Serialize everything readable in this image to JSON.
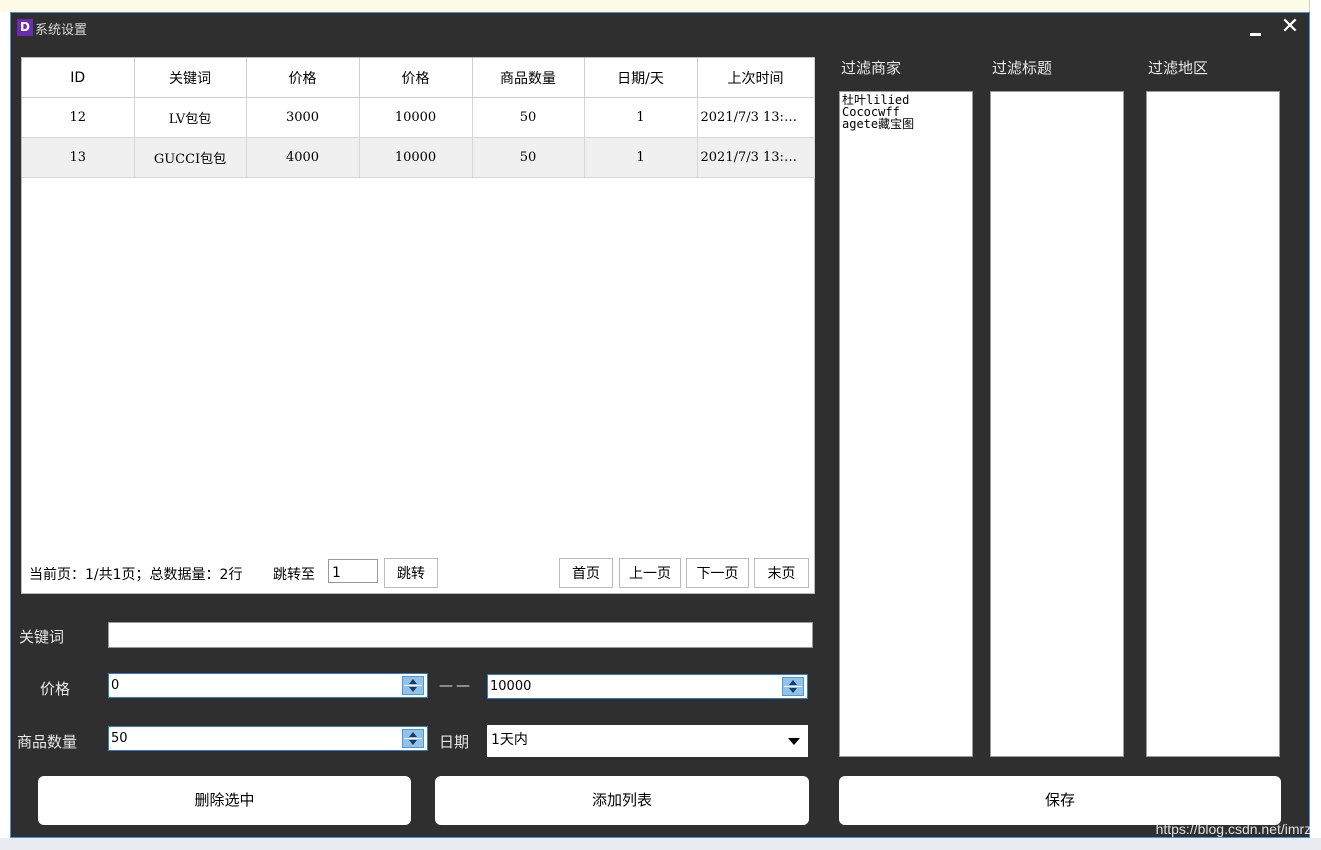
{
  "dialog": {
    "icon_letter": "D",
    "title": "系统设置"
  },
  "table": {
    "headers": [
      "ID",
      "关键词",
      "价格",
      "价格",
      "商品数量",
      "日期/天",
      "上次时间"
    ],
    "rows": [
      [
        "12",
        "LV包包",
        "3000",
        "10000",
        "50",
        "1",
        "2021/7/3 13:…"
      ],
      [
        "13",
        "GUCCI包包",
        "4000",
        "10000",
        "50",
        "1",
        "2021/7/3 13:…"
      ]
    ]
  },
  "pager": {
    "info": "当前页：1/共1页；总数据量：2行",
    "jump_to_label": "跳转至",
    "jump_value": "1",
    "jump_button": "跳转",
    "first": "首页",
    "prev": "上一页",
    "next": "下一页",
    "last": "末页"
  },
  "form": {
    "keyword_label": "关键词",
    "keyword_value": "",
    "price_label": "价格",
    "price_min": "0",
    "price_separator": "——",
    "price_max": "10000",
    "quantity_label": "商品数量",
    "quantity_value": "50",
    "date_label": "日期",
    "date_value": "1天内"
  },
  "buttons": {
    "delete_selected": "删除选中",
    "add_list": "添加列表",
    "save": "保存"
  },
  "filters": {
    "merchant_label": "过滤商家",
    "merchant_items": [
      "杜叶lilied",
      "Cococwff",
      "agete藏宝图"
    ],
    "title_label": "过滤标题",
    "region_label": "过滤地区"
  },
  "watermark": "https://blog.csdn.net/imrzh"
}
